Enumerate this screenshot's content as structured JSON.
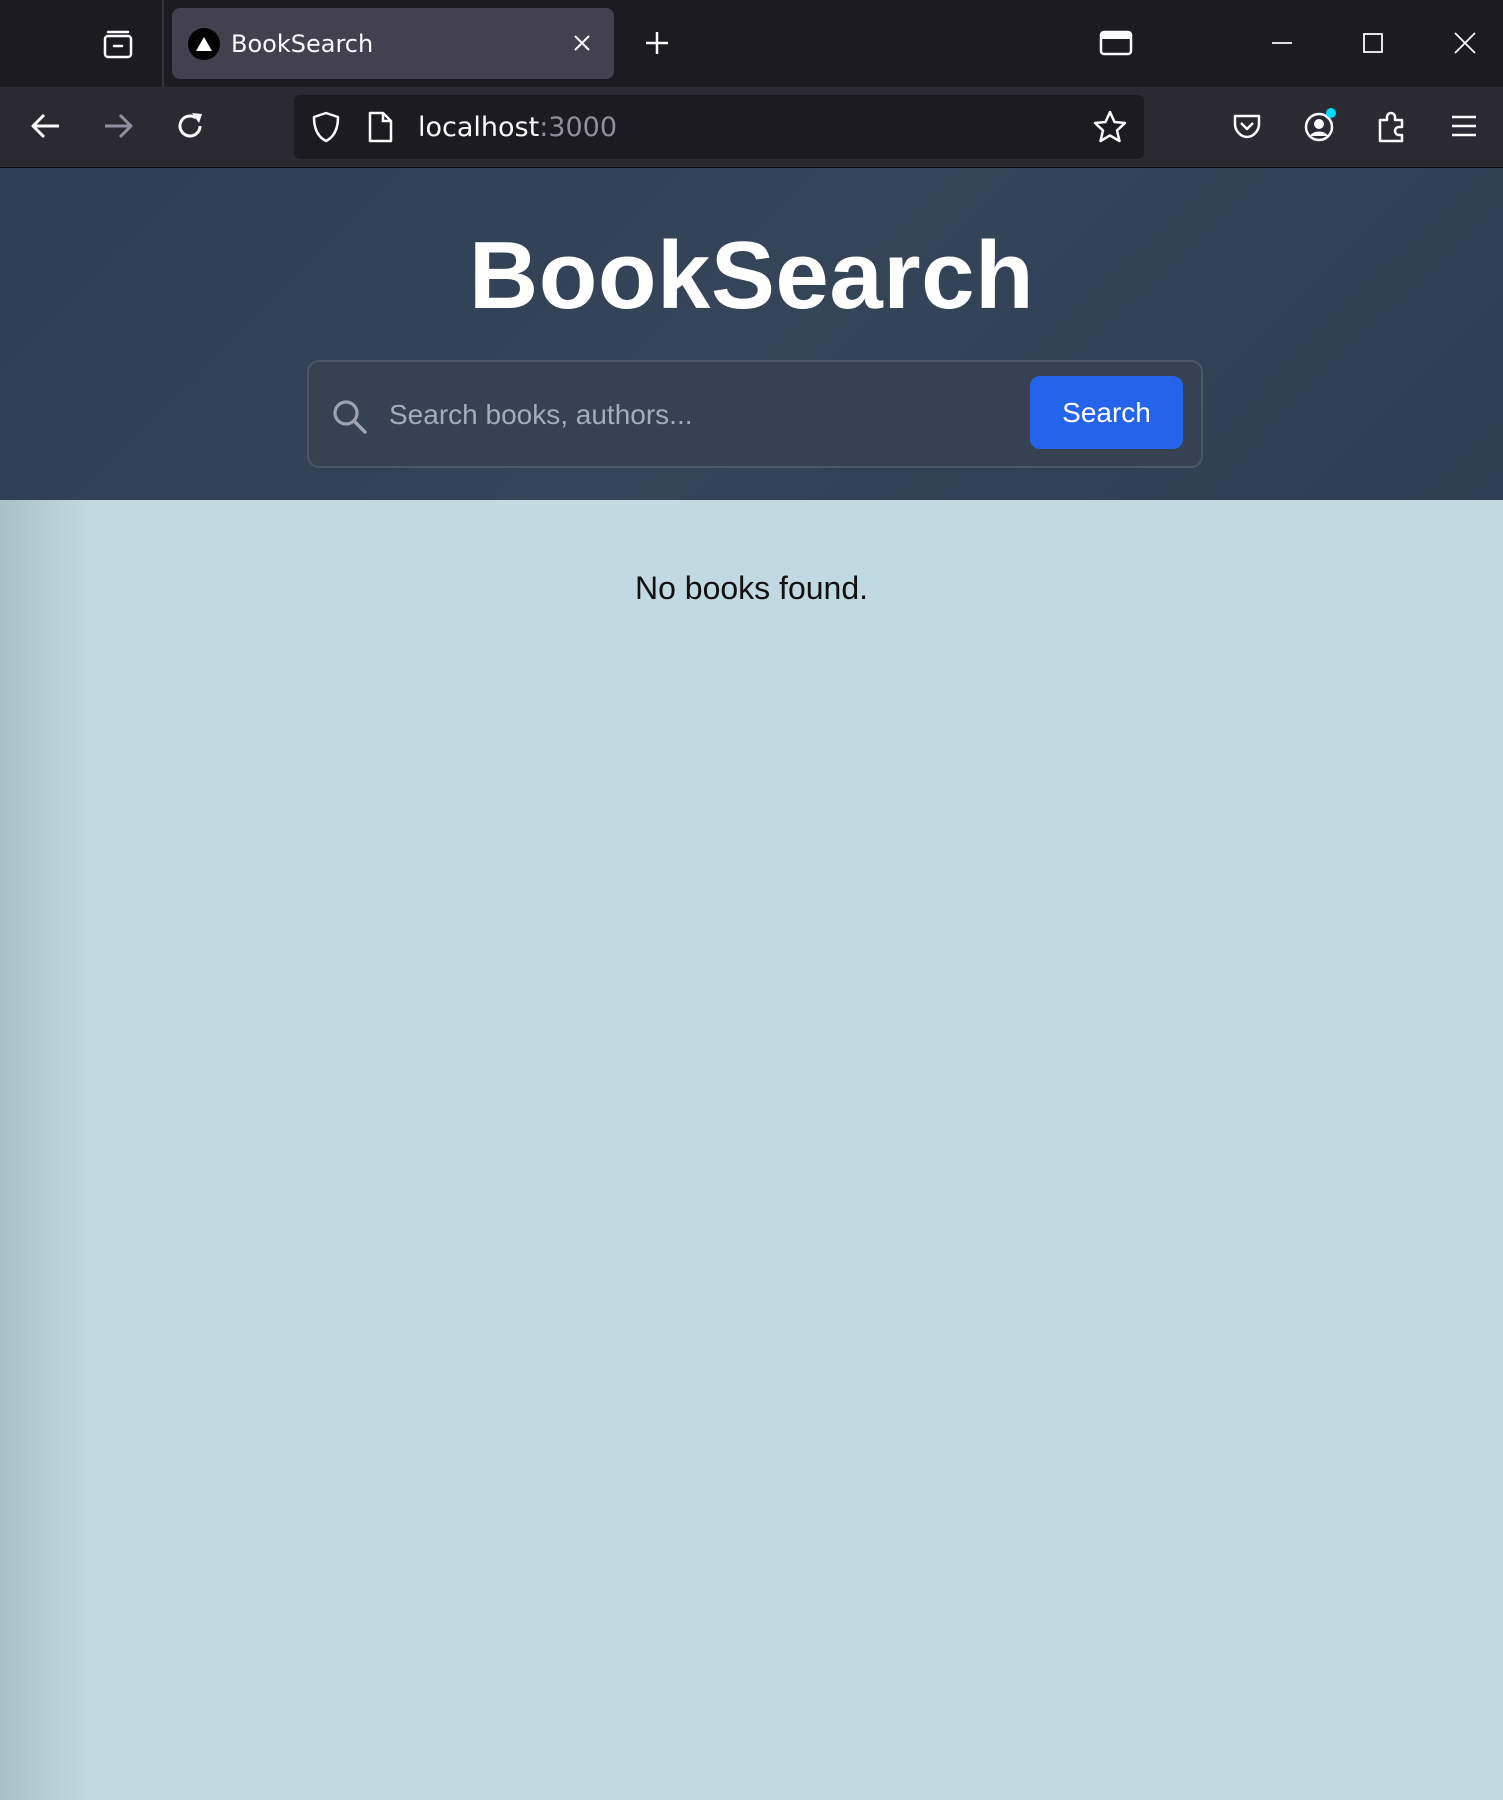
{
  "browser": {
    "tab": {
      "title": "BookSearch"
    },
    "url": {
      "host": "localhost",
      "port": ":3000"
    }
  },
  "page": {
    "title": "BookSearch",
    "search": {
      "placeholder": "Search books, authors...",
      "value": "",
      "button_label": "Search"
    },
    "empty_message": "No books found."
  },
  "colors": {
    "hero_background": "#334155",
    "page_background": "#c1d9e0",
    "accent": "#2563eb"
  },
  "icons": [
    "tab-list-icon",
    "app-logo-icon",
    "close-icon",
    "plus-icon",
    "window-icon",
    "minimize-icon",
    "maximize-icon",
    "window-close-icon",
    "back-icon",
    "forward-icon",
    "reload-icon",
    "shield-icon",
    "page-icon",
    "star-icon",
    "pocket-icon",
    "account-icon",
    "extensions-icon",
    "menu-icon",
    "search-icon"
  ]
}
